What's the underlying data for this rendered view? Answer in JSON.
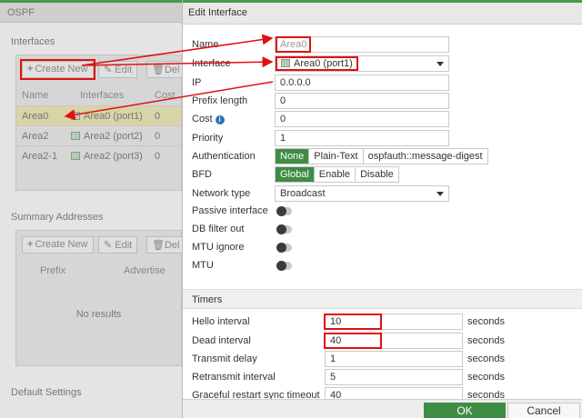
{
  "background": {
    "page_title": "OSPF",
    "interfaces": {
      "section_label": "Interfaces",
      "buttons": {
        "create": "Create New",
        "edit": "Edit",
        "delete": "Del"
      },
      "columns": [
        "Name",
        "Interfaces",
        "Cost"
      ],
      "rows": [
        {
          "name": "Area0",
          "interface": "Area0 (port1)",
          "cost": "0",
          "selected": true
        },
        {
          "name": "Area2",
          "interface": "Area2 (port2)",
          "cost": "0",
          "selected": false
        },
        {
          "name": "Area2-1",
          "interface": "Area2 (port3)",
          "cost": "0",
          "selected": false
        }
      ]
    },
    "summary": {
      "section_label": "Summary Addresses",
      "buttons": {
        "create": "Create New",
        "edit": "Edit",
        "delete": "Del"
      },
      "columns": [
        "Prefix",
        "Advertise"
      ],
      "empty_text": "No results"
    },
    "default_settings_label": "Default Settings"
  },
  "modal": {
    "title": "Edit Interface",
    "fields": {
      "name": {
        "label": "Name",
        "placeholder": "Area0"
      },
      "interface": {
        "label": "Interface",
        "value": "Area0 (port1)"
      },
      "ip": {
        "label": "IP",
        "value": "0.0.0.0"
      },
      "prefix_length": {
        "label": "Prefix length",
        "value": "0"
      },
      "cost": {
        "label": "Cost",
        "value": "0"
      },
      "priority": {
        "label": "Priority",
        "value": "1"
      },
      "authentication": {
        "label": "Authentication",
        "options": [
          "None",
          "Plain-Text",
          "ospfauth::message-digest"
        ],
        "selected": "None"
      },
      "bfd": {
        "label": "BFD",
        "options": [
          "Global",
          "Enable",
          "Disable"
        ],
        "selected": "Global"
      },
      "network_type": {
        "label": "Network type",
        "value": "Broadcast"
      },
      "passive_interface": {
        "label": "Passive interface",
        "on": false
      },
      "db_filter_out": {
        "label": "DB filter out",
        "on": false
      },
      "mtu_ignore": {
        "label": "MTU ignore",
        "on": false
      },
      "mtu": {
        "label": "MTU",
        "on": false
      }
    },
    "timers": {
      "header": "Timers",
      "unit": "seconds",
      "hello_interval": {
        "label": "Hello interval",
        "value": "10"
      },
      "dead_interval": {
        "label": "Dead interval",
        "value": "40"
      },
      "transmit_delay": {
        "label": "Transmit delay",
        "value": "1"
      },
      "retransmit_interval": {
        "label": "Retransmit interval",
        "value": "5"
      },
      "graceful_restart_sync_timeout": {
        "label": "Graceful restart sync timeout",
        "value": "40"
      }
    },
    "footer": {
      "ok": "OK",
      "cancel": "Cancel"
    }
  },
  "colors": {
    "accent_green": "#3f8c45",
    "annotation_red": "#e01010",
    "info_blue": "#2a72b5"
  }
}
